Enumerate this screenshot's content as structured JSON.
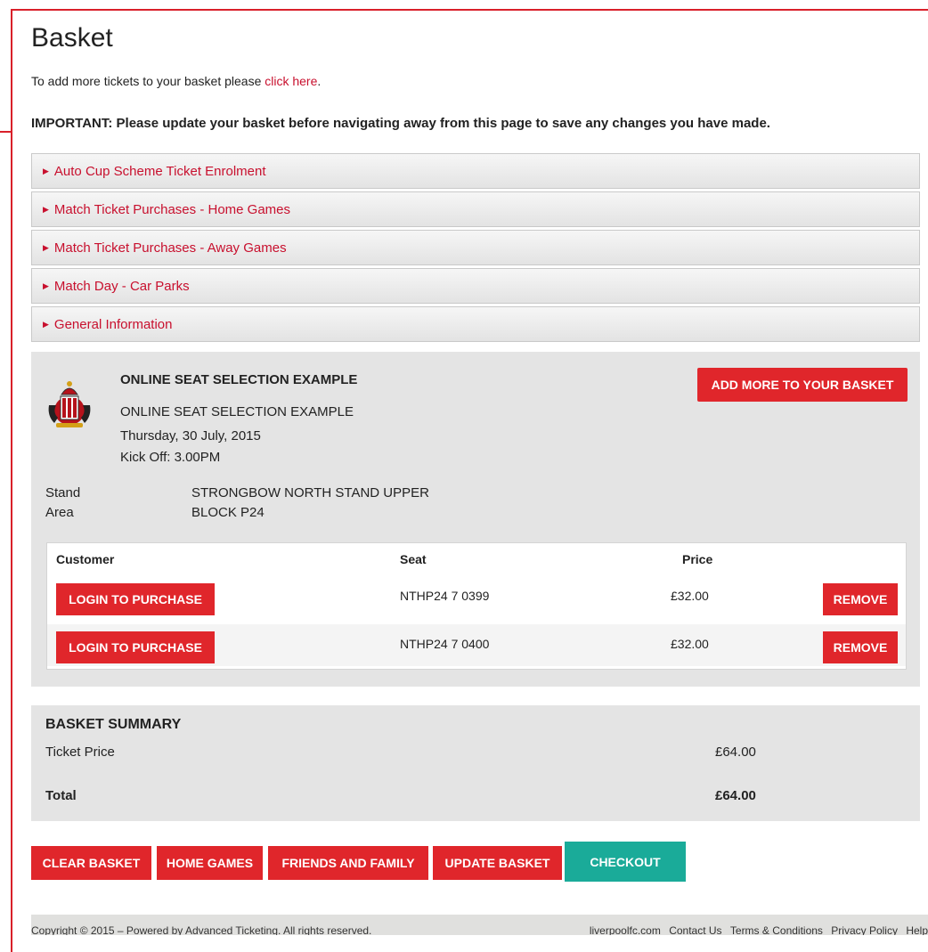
{
  "page": {
    "title": "Basket",
    "intro_text": "To add more tickets to your basket please ",
    "intro_link": "click here",
    "intro_end": ".",
    "important": "IMPORTANT: Please update your basket before navigating away from this page to save any changes you have made."
  },
  "accordion": [
    {
      "label": "Auto Cup Scheme Ticket Enrolment"
    },
    {
      "label": "Match Ticket Purchases - Home Games"
    },
    {
      "label": "Match Ticket Purchases - Away Games"
    },
    {
      "label": "Match Day - Car Parks"
    },
    {
      "label": "General Information"
    }
  ],
  "match": {
    "heading": "ONLINE SEAT SELECTION EXAMPLE",
    "name": "ONLINE SEAT SELECTION EXAMPLE",
    "date": "Thursday, 30 July, 2015",
    "kickoff": "Kick Off: 3.00PM",
    "add_more_label": "ADD MORE TO YOUR BASKET",
    "stand_label": "Stand",
    "stand_value": "STRONGBOW NORTH STAND UPPER",
    "area_label": "Area",
    "area_value": "BLOCK P24",
    "columns": {
      "customer": "Customer",
      "seat": "Seat",
      "price": "Price"
    },
    "rows": [
      {
        "customer_btn": "LOGIN TO PURCHASE",
        "seat": "NTHP24 7 0399",
        "price": "£32.00",
        "remove": "REMOVE"
      },
      {
        "customer_btn": "LOGIN TO PURCHASE",
        "seat": "NTHP24 7 0400",
        "price": "£32.00",
        "remove": "REMOVE"
      }
    ]
  },
  "summary": {
    "heading": "BASKET SUMMARY",
    "ticket_price_label": "Ticket Price",
    "ticket_price_value": "£64.00",
    "total_label": "Total",
    "total_value": "£64.00"
  },
  "actions": {
    "clear": "CLEAR BASKET",
    "home_games": "HOME GAMES",
    "friends": "FRIENDS AND FAMILY",
    "update": "UPDATE BASKET",
    "checkout": "CHECKOUT"
  },
  "footer": {
    "copyright": "Copyright © 2015 – Powered by Advanced Ticketing. All rights reserved.",
    "links": [
      "liverpoolfc.com",
      "Contact Us",
      "Terms & Conditions",
      "Privacy Policy",
      "Help"
    ]
  },
  "colors": {
    "accent": "#e0262b",
    "link": "#c8102e",
    "checkout": "#1aab99",
    "panel": "#e4e4e4"
  }
}
